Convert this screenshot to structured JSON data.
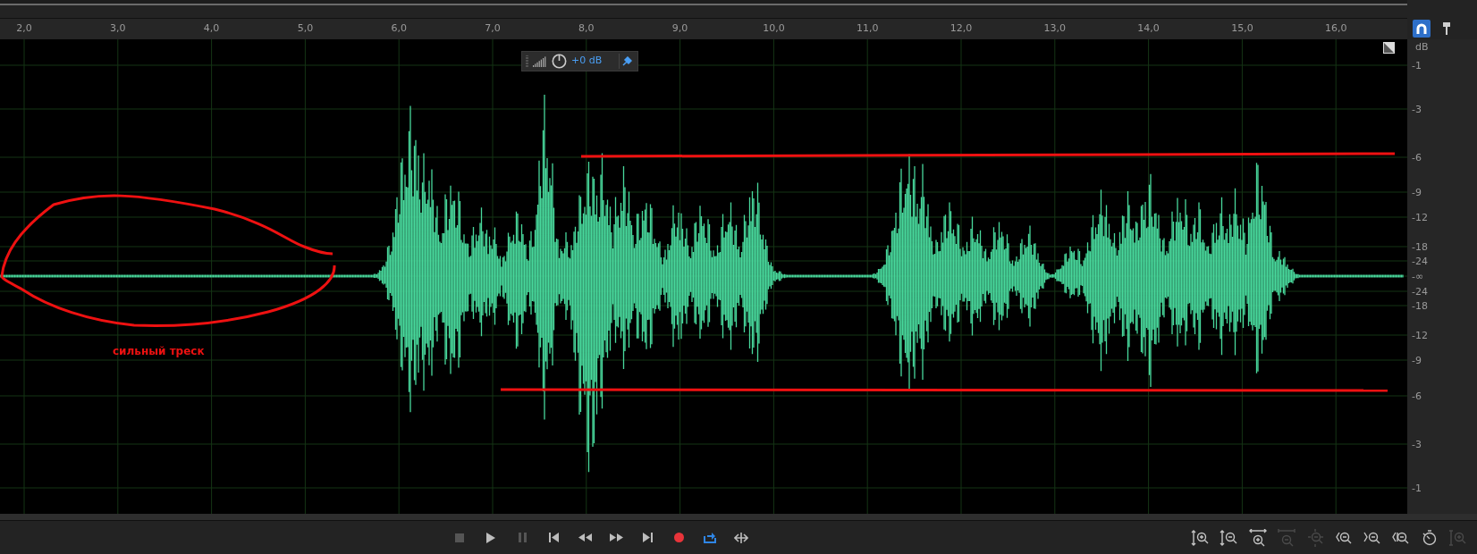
{
  "ruler": {
    "ticks": [
      "2,0",
      "3,0",
      "4,0",
      "5,0",
      "6,0",
      "7,0",
      "8,0",
      "9,0",
      "10,0",
      "11,0",
      "12,0",
      "13,0",
      "14,0",
      "15,0",
      "16,0"
    ]
  },
  "toolbar_toggles": [
    {
      "kind": "snap",
      "selected": true
    },
    {
      "kind": "marker",
      "selected": false
    }
  ],
  "hud": {
    "gain": "+0 dB",
    "pinned": true
  },
  "db_scale": {
    "unit": "dB",
    "labels": [
      "-1",
      "-3",
      "-6",
      "-9",
      "-12",
      "-18",
      "-24",
      "-∞",
      "-24",
      "-18",
      "-12",
      "-9",
      "-6",
      "-3",
      "-1"
    ]
  },
  "annotation": {
    "note": "сильный треск"
  },
  "transport": [
    {
      "kind": "stop",
      "disabled": true,
      "active": false
    },
    {
      "kind": "play",
      "disabled": false,
      "active": false
    },
    {
      "kind": "pause",
      "disabled": true,
      "active": false
    },
    {
      "kind": "start",
      "disabled": false,
      "active": false
    },
    {
      "kind": "rewind",
      "disabled": false,
      "active": false
    },
    {
      "kind": "forward",
      "disabled": false,
      "active": false
    },
    {
      "kind": "end",
      "disabled": false,
      "active": false
    },
    {
      "kind": "record",
      "disabled": false,
      "active": false
    },
    {
      "kind": "loop",
      "disabled": false,
      "active": true
    },
    {
      "kind": "skip",
      "disabled": false,
      "active": false
    }
  ],
  "zoom_tools": [
    {
      "kind": "amp-in",
      "disabled": false
    },
    {
      "kind": "amp-out",
      "disabled": false
    },
    {
      "kind": "time-in",
      "disabled": false
    },
    {
      "kind": "time-out",
      "disabled": true
    },
    {
      "kind": "full",
      "disabled": true
    },
    {
      "kind": "in-left",
      "disabled": false
    },
    {
      "kind": "in-right",
      "disabled": false
    },
    {
      "kind": "selection",
      "disabled": false
    },
    {
      "kind": "history",
      "disabled": false
    },
    {
      "kind": "tracks",
      "disabled": true
    }
  ]
}
